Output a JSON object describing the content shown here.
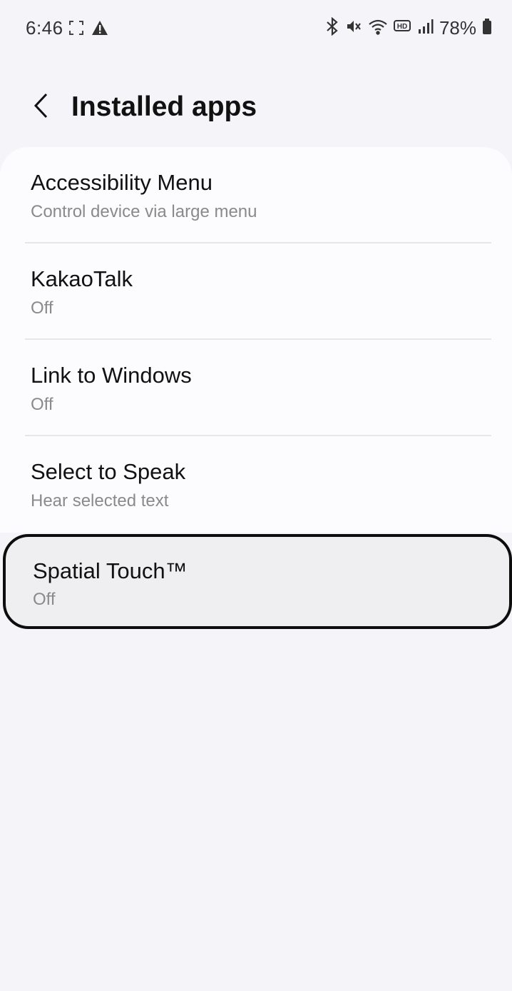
{
  "status_bar": {
    "time": "6:46",
    "battery": "78%",
    "icons": [
      "screenshot-frame-icon",
      "warning-icon",
      "bluetooth-icon",
      "mute-icon",
      "wifi-icon",
      "hd-voice-icon",
      "signal-icon",
      "battery-icon"
    ]
  },
  "header": {
    "back_icon": "chevron-left-icon",
    "title": "Installed apps"
  },
  "apps": [
    {
      "title": "Accessibility Menu",
      "subtitle": "Control device via large menu"
    },
    {
      "title": "KakaoTalk",
      "subtitle": "Off"
    },
    {
      "title": "Link to Windows",
      "subtitle": "Off"
    },
    {
      "title": "Select to Speak",
      "subtitle": "Hear selected text"
    },
    {
      "title": "Spatial Touch™",
      "subtitle": "Off"
    }
  ],
  "colors": {
    "background": "#f5f4f8",
    "card": "#fcfcfe",
    "subtitle": "#8a8a8a",
    "focus_border": "#0d0d0d"
  }
}
